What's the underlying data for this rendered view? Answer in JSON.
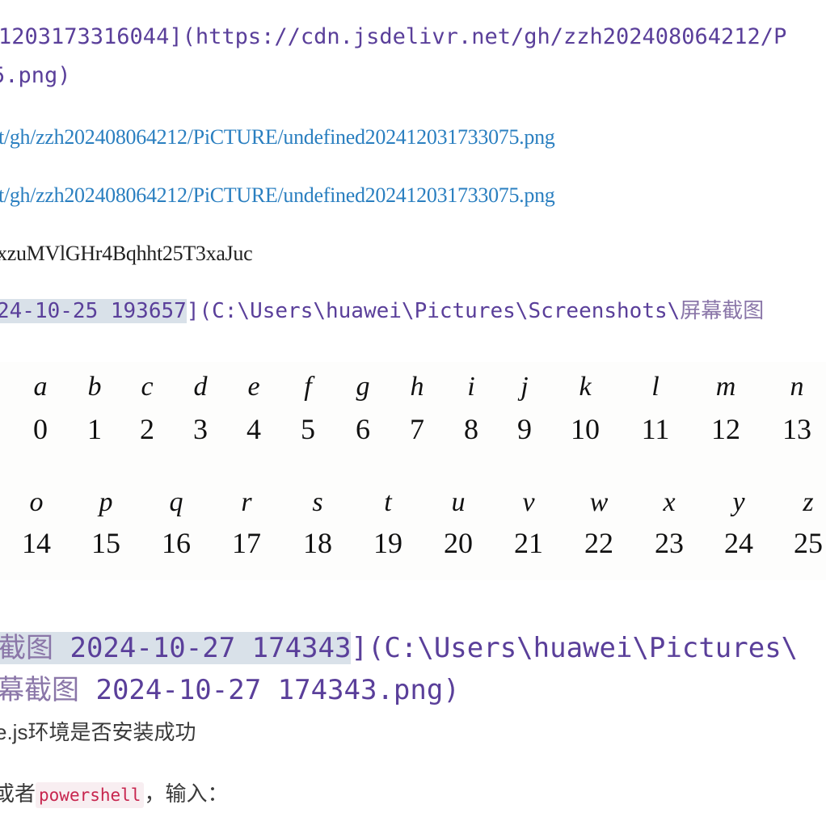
{
  "lines": {
    "l1": "1203173316044](https://cdn.jsdelivr.net/gh/zzh202408064212/P",
    "l2": "5.png)",
    "l3": "t/gh/zzh202408064212/PiCTURE/undefined202412031733075.png",
    "l4": "t/gh/zzh202408064212/PiCTURE/undefined202412031733075.png",
    "l5": "xzuMVlGHr4Bqhht25T3xaJuc",
    "l6_hl": "24-10-25 193657",
    "l6_rest": "](C:\\Users\\huawei\\Pictures\\Screenshots\\",
    "l6_cjk": "屏幕截图",
    "l7_cjk": "截图",
    "l7_hl": " 2024-10-27 174343",
    "l7_rest": "](C:\\Users\\huawei\\Pictures\\",
    "l8_cjk": "幕截图",
    "l8_rest": " 2024-10-27 174343.png)",
    "l9": "e.js环境是否安装成功",
    "l10_pre": "或者",
    "l10_code": "powershell",
    "l10_post": "，输入："
  },
  "alphabet_image": {
    "row1": {
      "letters": [
        "a",
        "b",
        "c",
        "d",
        "e",
        "f",
        "g",
        "h",
        "i",
        "j",
        "k",
        "l",
        "m",
        "n"
      ],
      "numbers": [
        "0",
        "1",
        "2",
        "3",
        "4",
        "5",
        "6",
        "7",
        "8",
        "9",
        "10",
        "11",
        "12",
        "13"
      ]
    },
    "row2": {
      "letters": [
        "o",
        "p",
        "q",
        "r",
        "s",
        "t",
        "u",
        "v",
        "w",
        "x",
        "y",
        "z"
      ],
      "numbers": [
        "14",
        "15",
        "16",
        "17",
        "18",
        "19",
        "20",
        "21",
        "22",
        "23",
        "24",
        "25"
      ]
    }
  }
}
